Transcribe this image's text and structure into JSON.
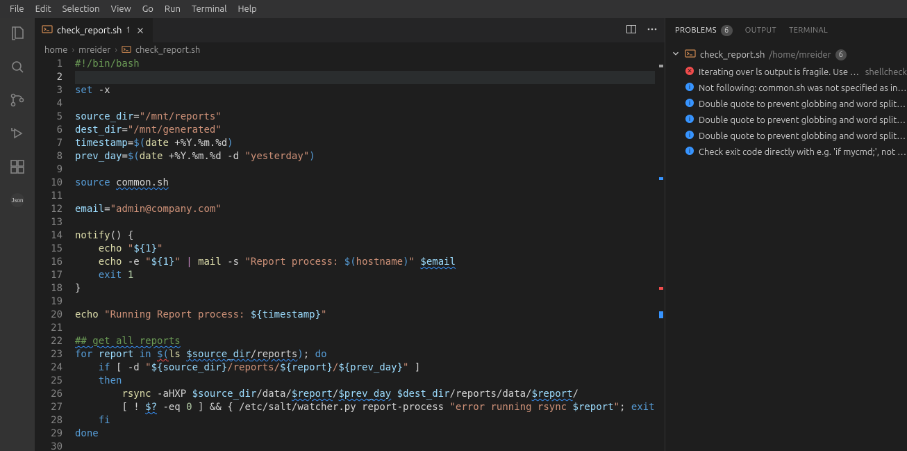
{
  "menu": {
    "items": [
      "File",
      "Edit",
      "Selection",
      "View",
      "Go",
      "Run",
      "Terminal",
      "Help"
    ]
  },
  "activitybar": {
    "icons": [
      "files-icon",
      "search-icon",
      "source-control-icon",
      "debug-icon",
      "extensions-icon",
      "json-icon"
    ]
  },
  "tab": {
    "filename": "check_report.sh",
    "dirty_indicator": "1"
  },
  "breadcrumbs": {
    "segments": [
      "home",
      "mreider"
    ],
    "file": "check_report.sh"
  },
  "editor": {
    "lines": [
      "#!/bin/bash",
      "",
      "set -x",
      "",
      "source_dir=\"/mnt/reports\"",
      "dest_dir=\"/mnt/generated\"",
      "timestamp=$(date +%Y.%m.%d)",
      "prev_day=$(date +%Y.%m.%d -d \"yesterday\")",
      "",
      "source common.sh",
      "",
      "email=\"admin@company.com\"",
      "",
      "notify() {",
      "    echo \"${1}\"",
      "    echo -e \"${1}\" | mail -s \"Report process: $(hostname)\" $email",
      "    exit 1",
      "}",
      "",
      "echo \"Running Report process: ${timestamp}\"",
      "",
      "## get all reports",
      "for report in $(ls $source_dir/reports); do",
      "    if [ -d \"${source_dir}/reports/${report}/${prev_day}\" ]",
      "    then",
      "        rsync -aHXP $source_dir/data/$report/$prev_day $dest_dir/reports/data/$report/",
      "        [ ! $? -eq 0 ] && { /etc/salt/watcher.py report-process \"error running rsync $report\"; exit",
      "    fi",
      "done",
      ""
    ],
    "current_line": 2
  },
  "panel": {
    "tabs": [
      {
        "label": "PROBLEMS",
        "badge": "6",
        "active": true
      },
      {
        "label": "OUTPUT"
      },
      {
        "label": "TERMINAL"
      }
    ],
    "file": {
      "name": "check_report.sh",
      "path": "/home/mreider",
      "badge": "6"
    },
    "items": [
      {
        "sev": "error",
        "msg": "Iterating over ls output is fragile. Use globs.",
        "src": "shellcheck"
      },
      {
        "sev": "info",
        "msg": "Not following: common.sh was not specified as input"
      },
      {
        "sev": "info",
        "msg": "Double quote to prevent globbing and word splitting."
      },
      {
        "sev": "info",
        "msg": "Double quote to prevent globbing and word splitting."
      },
      {
        "sev": "info",
        "msg": "Double quote to prevent globbing and word splitting."
      },
      {
        "sev": "info",
        "msg": "Check exit code directly with e.g. 'if mycmd;', not indirectly"
      }
    ]
  },
  "colors": {
    "accent": "#3794ff",
    "error": "#f14c4c"
  }
}
